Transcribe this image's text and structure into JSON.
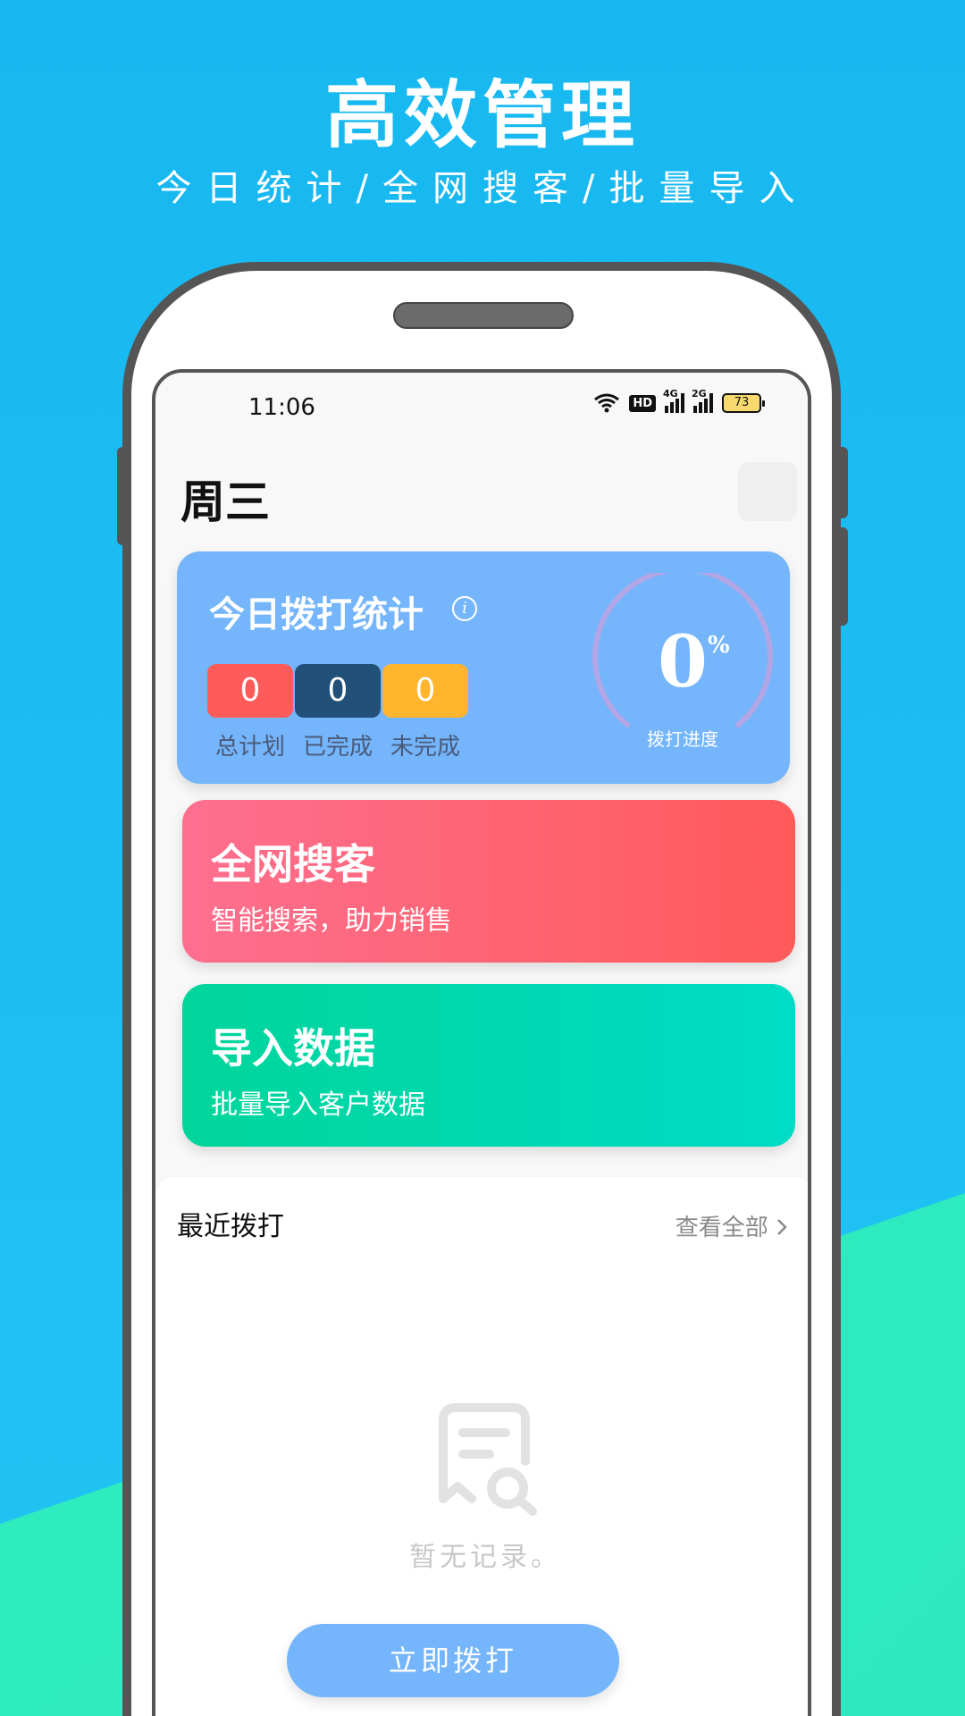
{
  "promo": {
    "title": "高效管理",
    "subtitle": "今日统计/全网搜客/批量导入"
  },
  "status_bar": {
    "time": "11:06",
    "hd": "HD",
    "net1": "4G",
    "net2": "2G",
    "battery": "73"
  },
  "header": {
    "day": "周三"
  },
  "stats": {
    "title": "今日拨打统计",
    "info_glyph": "i",
    "total_plan": {
      "value": "0",
      "label": "总计划",
      "color": "#ff5b5b"
    },
    "completed": {
      "value": "0",
      "label": "已完成",
      "color": "#215078"
    },
    "incomplete": {
      "value": "0",
      "label": "未完成",
      "color": "#ffb52e"
    },
    "progress": {
      "value": "0",
      "unit": "%",
      "label": "拨打进度",
      "fraction": 0
    }
  },
  "cards": {
    "search": {
      "title": "全网搜客",
      "subtitle": "智能搜索，助力销售"
    },
    "import": {
      "title": "导入数据",
      "subtitle": "批量导入客户数据"
    }
  },
  "recent": {
    "title": "最近拨打",
    "view_all": "查看全部",
    "empty_text": "暂无记录。",
    "dial_button": "立即拨打"
  },
  "colors": {
    "brand_blue": "#74b5fb",
    "bg_blue": "#17b8f1",
    "bg_green": "#30f0bd"
  }
}
